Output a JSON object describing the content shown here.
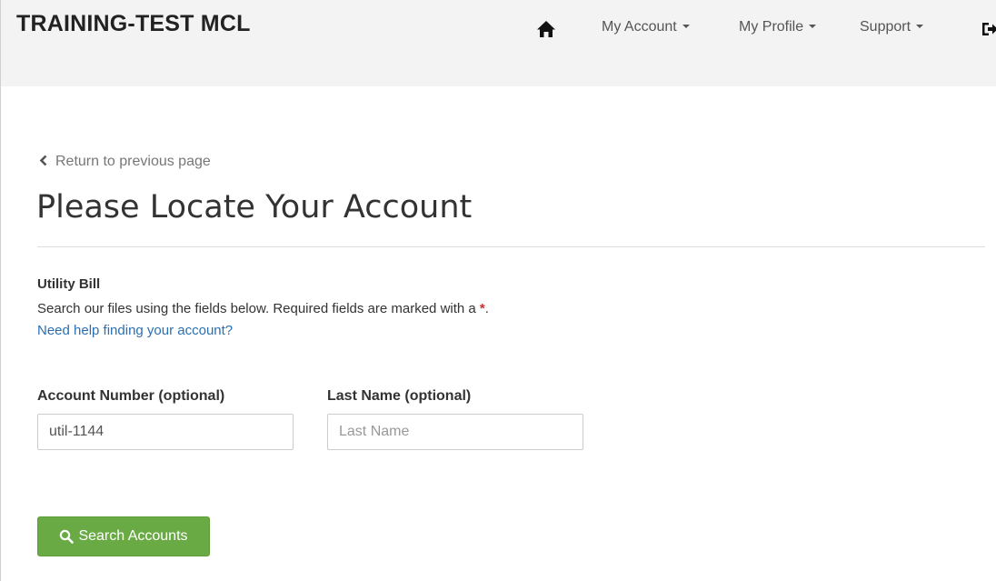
{
  "header": {
    "brand": "TRAINING-TEST MCL",
    "nav": {
      "home_icon": "home-icon",
      "my_account": "My Account",
      "my_profile": "My Profile",
      "support": "Support",
      "logout_icon": "sign-out-icon"
    },
    "background_color": "#f3f3f3"
  },
  "main": {
    "back_link": "Return to previous page",
    "title": "Please Locate Your Account",
    "section_label": "Utility Bill",
    "instructions": "Search our files using the fields below.  Required fields are marked with a ",
    "required_marker": "*",
    "instructions_end": ".",
    "help_link": "Need help finding your account?",
    "form": {
      "account_number": {
        "label": "Account Number (optional)",
        "value": "util-1144",
        "placeholder": "Account Number"
      },
      "last_name": {
        "label": "Last Name (optional)",
        "value": "",
        "placeholder": "Last Name"
      },
      "search_button": "Search Accounts"
    }
  },
  "colors": {
    "accent_green": "#6aaa44",
    "link_blue": "#2a6fb2",
    "required_red": "#c9302c"
  }
}
